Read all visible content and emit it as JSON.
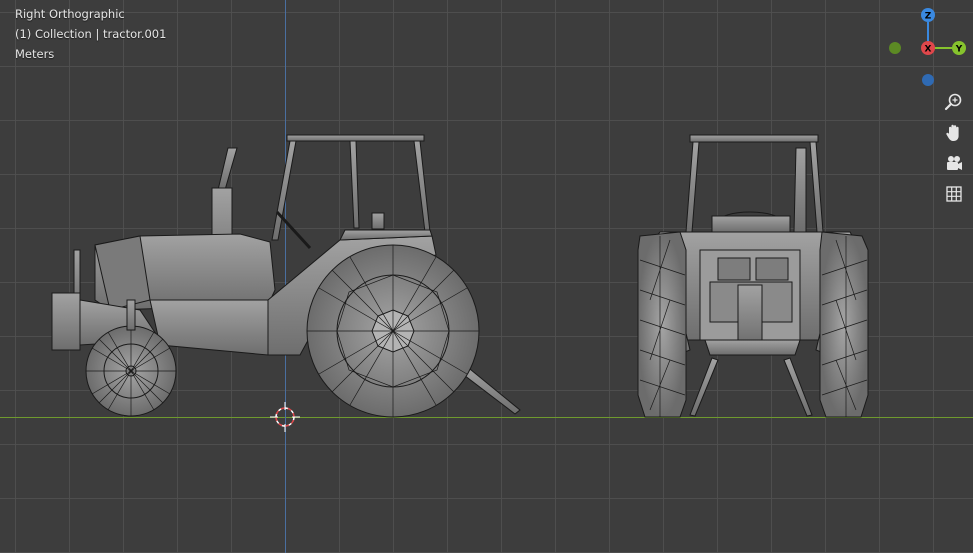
{
  "viewport": {
    "view_name": "Right Orthographic",
    "collection_label": "(1) Collection | tractor.001",
    "units": "Meters"
  },
  "gizmo": {
    "z_label": "Z",
    "x_label": "X",
    "y_label": "Y",
    "colors": {
      "x": "#e0474b",
      "y": "#86c32d",
      "z": "#3a89e0",
      "neg_y": "#5c8a24",
      "neg_z": "#2f6ab3"
    }
  },
  "nav_buttons": [
    {
      "name": "zoom-icon"
    },
    {
      "name": "pan-hand-icon"
    },
    {
      "name": "camera-icon"
    },
    {
      "name": "grid-icon"
    }
  ],
  "colors": {
    "background": "#3d3d3d",
    "grid": "#505050",
    "x_axis": "#6f9a2e",
    "z_axis": "#4a6fa0",
    "model_fill": "#8a8a8a",
    "model_edge": "#1a1a1a"
  }
}
